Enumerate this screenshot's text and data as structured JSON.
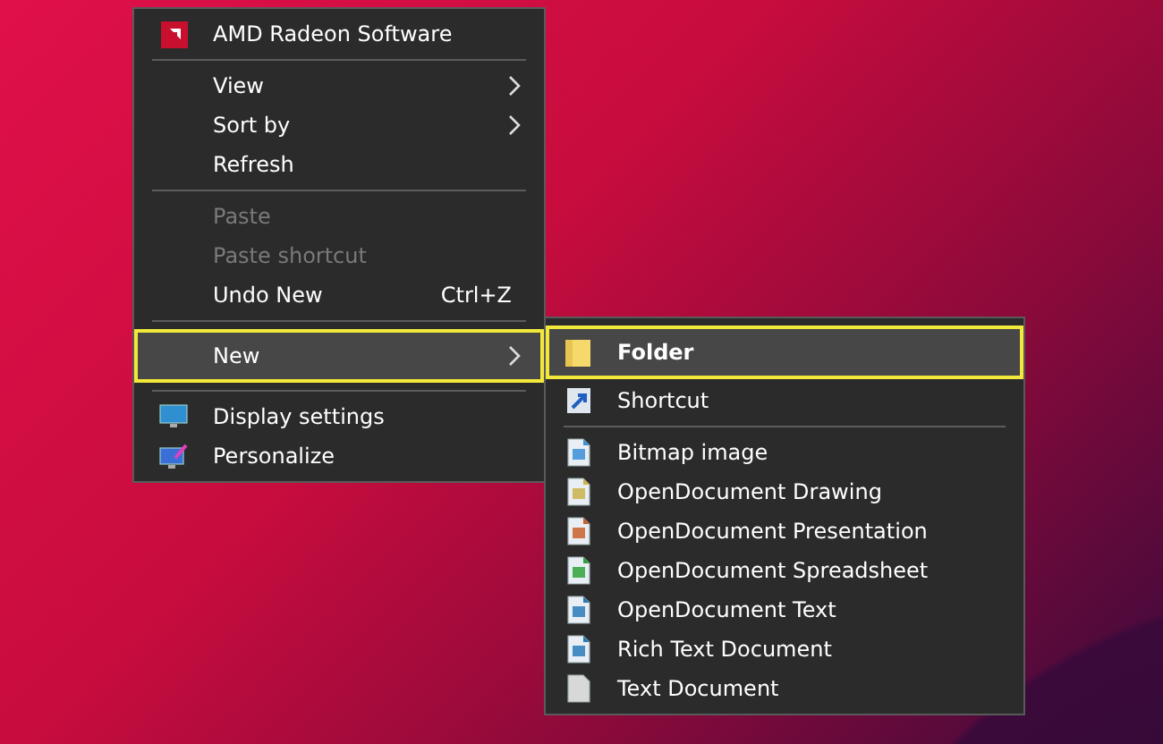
{
  "context_menu": {
    "items": [
      {
        "kind": "item",
        "label": "AMD Radeon Software",
        "disabled": false,
        "highlighted": false,
        "submenu": false
      },
      {
        "kind": "separator"
      },
      {
        "kind": "item",
        "label": "View",
        "disabled": false,
        "highlighted": false,
        "submenu": true
      },
      {
        "kind": "item",
        "label": "Sort by",
        "disabled": false,
        "highlighted": false,
        "submenu": true
      },
      {
        "kind": "item",
        "label": "Refresh",
        "disabled": false,
        "highlighted": false,
        "submenu": false
      },
      {
        "kind": "separator"
      },
      {
        "kind": "item",
        "label": "Paste",
        "disabled": true,
        "highlighted": false,
        "submenu": false
      },
      {
        "kind": "item",
        "label": "Paste shortcut",
        "disabled": true,
        "highlighted": false,
        "submenu": false
      },
      {
        "kind": "item",
        "label": "Undo New",
        "shortcut": "Ctrl+Z",
        "disabled": false,
        "highlighted": false,
        "submenu": false
      },
      {
        "kind": "separator"
      },
      {
        "kind": "item",
        "label": "New",
        "disabled": false,
        "highlighted": true,
        "submenu": true
      },
      {
        "kind": "separator"
      },
      {
        "kind": "item",
        "label": "Display settings",
        "disabled": false,
        "highlighted": false,
        "submenu": false
      },
      {
        "kind": "item",
        "label": "Personalize",
        "disabled": false,
        "highlighted": false,
        "submenu": false
      }
    ]
  },
  "new_submenu": {
    "items": [
      {
        "kind": "item",
        "label": "Folder",
        "highlighted": true
      },
      {
        "kind": "item",
        "label": "Shortcut",
        "highlighted": false
      },
      {
        "kind": "separator"
      },
      {
        "kind": "item",
        "label": "Bitmap image",
        "highlighted": false
      },
      {
        "kind": "item",
        "label": "OpenDocument Drawing",
        "highlighted": false
      },
      {
        "kind": "item",
        "label": "OpenDocument Presentation",
        "highlighted": false
      },
      {
        "kind": "item",
        "label": "OpenDocument Spreadsheet",
        "highlighted": false
      },
      {
        "kind": "item",
        "label": "OpenDocument Text",
        "highlighted": false
      },
      {
        "kind": "item",
        "label": "Rich Text Document",
        "highlighted": false
      },
      {
        "kind": "item",
        "label": "Text Document",
        "highlighted": false
      }
    ]
  }
}
